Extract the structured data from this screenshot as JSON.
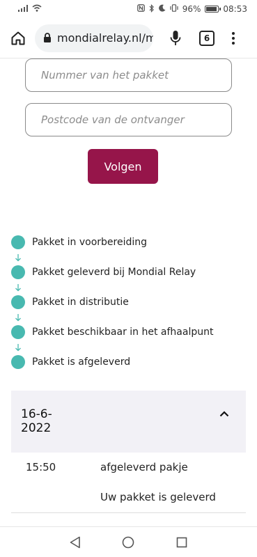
{
  "status_bar": {
    "battery_percent": "96%",
    "battery_level": 0.96,
    "time": "08:53",
    "icons": [
      "signal-icon",
      "wifi-icon",
      "nfc-icon",
      "bluetooth-icon",
      "moon-icon",
      "vibrate-icon",
      "battery-icon"
    ]
  },
  "browser": {
    "url": "mondialrelay.nl/m",
    "tab_count": "6",
    "icons": [
      "home-icon",
      "lock-icon",
      "mic-icon",
      "tabs-icon",
      "menu-icon"
    ]
  },
  "form": {
    "package_placeholder": "Nummer van het pakket",
    "postcode_placeholder": "Postcode van de ontvanger",
    "follow_label": "Volgen",
    "button_color": "#96154a"
  },
  "timeline": {
    "dot_color": "#48b9b0",
    "steps": [
      "Pakket in voorbereiding",
      "Pakket geleverd bij Mondial Relay",
      "Pakket in distributie",
      "Pakket beschikbaar in het afhaalpunt",
      "Pakket is afgeleverd"
    ]
  },
  "history": {
    "date": "16-6-2022",
    "events": [
      {
        "time": "15:50",
        "title": "afgeleverd pakje",
        "description": "Uw pakket is geleverd"
      }
    ]
  },
  "nav": {
    "icons": [
      "back-icon",
      "home-circle-icon",
      "recents-icon"
    ]
  }
}
